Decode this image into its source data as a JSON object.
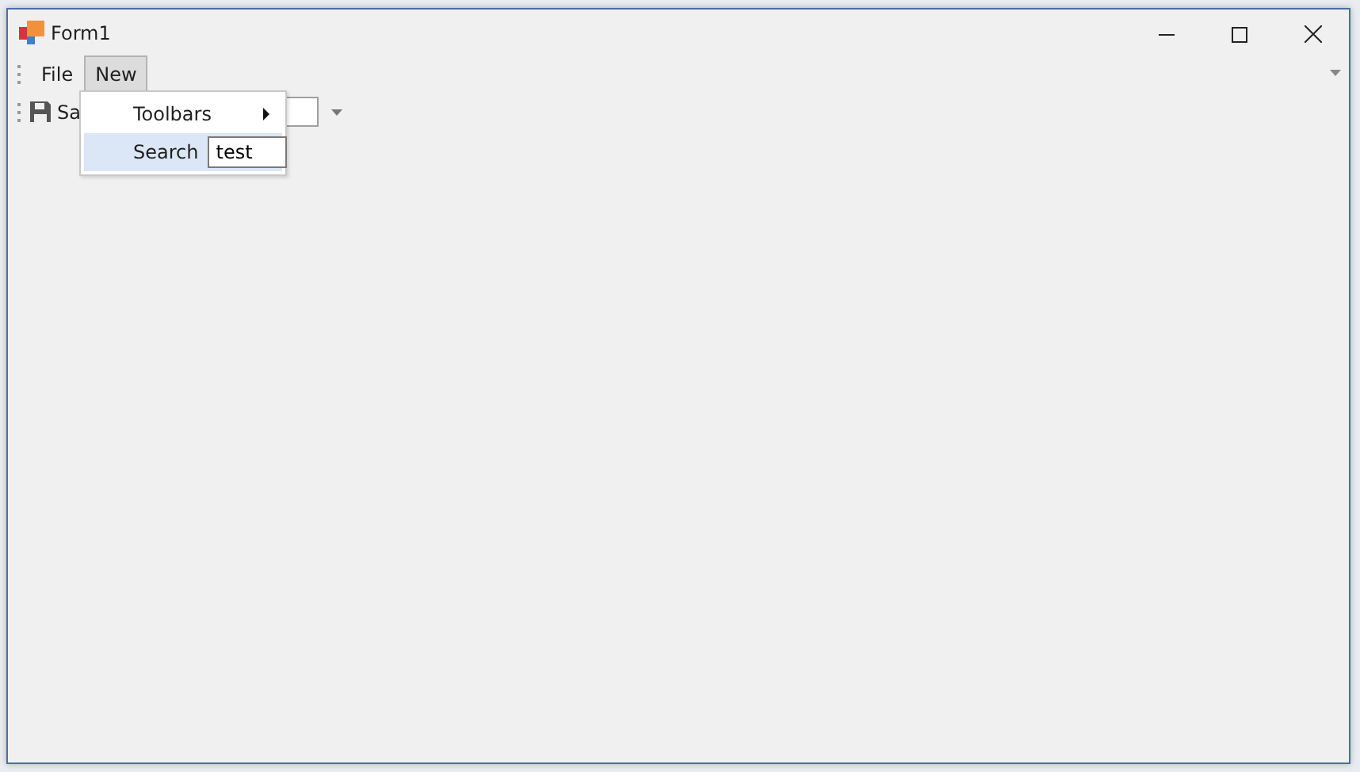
{
  "window": {
    "title": "Form1"
  },
  "menu_bar": [
    {
      "label": "File",
      "selected": false
    },
    {
      "label": "New",
      "selected": true
    }
  ],
  "toolbar": {
    "save_label": "Sa"
  },
  "dropdown_menu": [
    {
      "kind": "submenu",
      "label": "Toolbars",
      "selected": false
    },
    {
      "kind": "textbox",
      "label": "Search",
      "value": "test",
      "selected": true
    }
  ]
}
